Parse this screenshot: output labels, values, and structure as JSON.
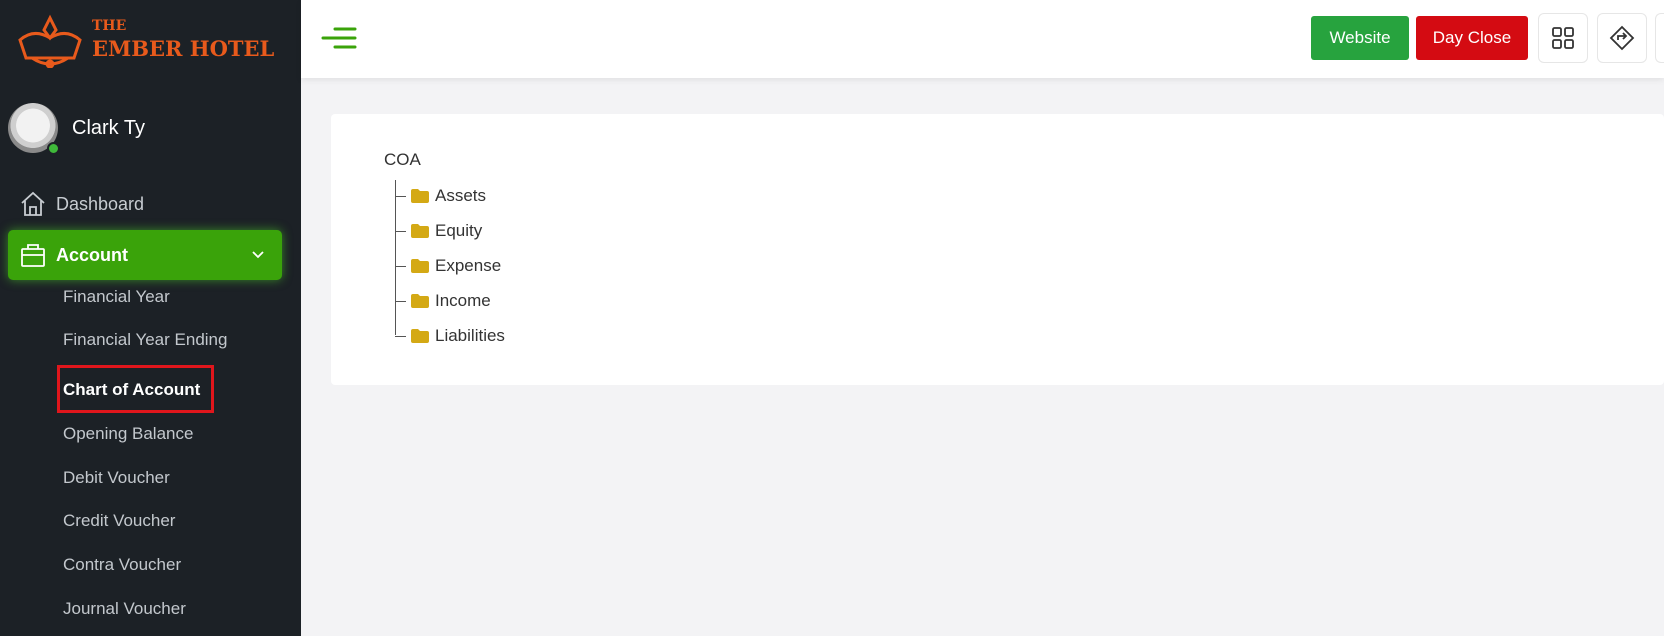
{
  "brand": {
    "logo_line1": "THE",
    "logo_line2": "EMBER HOTEL",
    "accent": "#e85a1c"
  },
  "user": {
    "name": "Clark Ty",
    "status": "online"
  },
  "sidebar": {
    "items": [
      {
        "label": "Dashboard",
        "icon": "home-icon"
      },
      {
        "label": "Account",
        "icon": "briefcase-icon",
        "expanded": true
      }
    ],
    "account_submenu": [
      "Financial Year",
      "Financial Year Ending",
      "Chart of Account",
      "Opening Balance",
      "Debit Voucher",
      "Credit Voucher",
      "Contra Voucher",
      "Journal Voucher"
    ],
    "active_submenu": "Chart of Account"
  },
  "header": {
    "website_label": "Website",
    "day_close_label": "Day Close",
    "website_color": "#27a33e",
    "day_close_color": "#d40b12"
  },
  "tree": {
    "root": "COA",
    "children": [
      "Assets",
      "Equity",
      "Expense",
      "Income",
      "Liabilities"
    ],
    "folder_color": "#d4a915"
  }
}
